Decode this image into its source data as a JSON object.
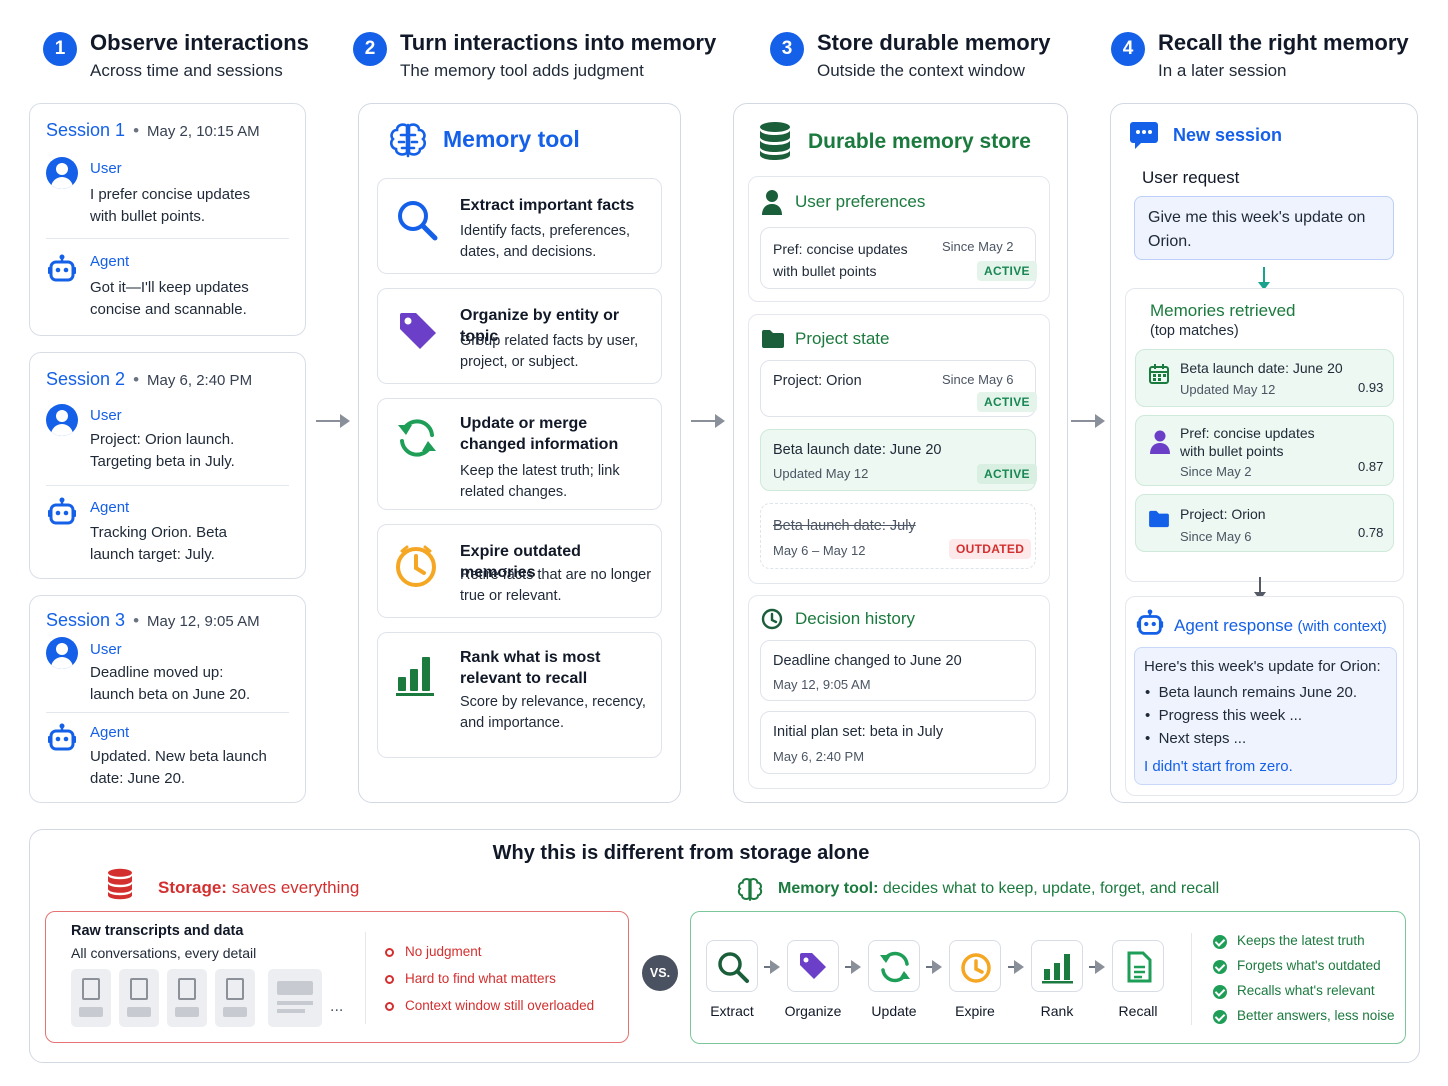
{
  "steps": [
    {
      "num": "1",
      "title": "Observe interactions",
      "subtitle": "Across time and sessions"
    },
    {
      "num": "2",
      "title": "Turn interactions into memory",
      "subtitle": "The memory tool adds judgment"
    },
    {
      "num": "3",
      "title": "Store durable memory",
      "subtitle": "Outside the context window"
    },
    {
      "num": "4",
      "title": "Recall the right memory",
      "subtitle": "In a later session"
    }
  ],
  "sessions": [
    {
      "title": "Session 1",
      "date": "May 2, 10:15 AM",
      "user_label": "User",
      "user_msg": "I prefer concise updates with bullet points.",
      "agent_label": "Agent",
      "agent_msg": "Got it—I'll keep updates concise and scannable."
    },
    {
      "title": "Session 2",
      "date": "May 6, 2:40 PM",
      "user_label": "User",
      "user_msg": "Project: Orion launch. Targeting beta in July.",
      "agent_label": "Agent",
      "agent_msg": "Tracking Orion. Beta launch target: July."
    },
    {
      "title": "Session 3",
      "date": "May 12, 9:05 AM",
      "user_label": "User",
      "user_msg": "Deadline moved up: launch beta on June 20.",
      "agent_label": "Agent",
      "agent_msg": "Updated. New beta launch date: June 20."
    }
  ],
  "memory_tool": {
    "title": "Memory tool",
    "features": [
      {
        "title": "Extract important facts",
        "desc": "Identify facts, preferences, dates, and decisions.",
        "icon": "search-icon"
      },
      {
        "title": "Organize by entity or topic",
        "desc": "Group related facts by user, project, or subject.",
        "icon": "tag-icon"
      },
      {
        "title": "Update or merge changed information",
        "desc": "Keep the latest truth; link related changes.",
        "icon": "refresh-icon"
      },
      {
        "title": "Expire outdated memories",
        "desc": "Retire facts that are no longer true or relevant.",
        "icon": "clock-icon"
      },
      {
        "title": "Rank what is most relevant to recall",
        "desc": "Score by relevance, recency, and importance.",
        "icon": "bar-chart-icon"
      }
    ]
  },
  "store": {
    "title": "Durable memory store",
    "preferences": {
      "title": "User preferences",
      "item": "Pref: concise updates with bullet points",
      "since": "Since May 2",
      "status": "ACTIVE"
    },
    "project": {
      "title": "Project state",
      "items": [
        {
          "text": "Project: Orion",
          "meta": "Since May 6",
          "status": "ACTIVE"
        },
        {
          "text": "Beta launch date: June 20",
          "meta": "Updated May 12",
          "status": "ACTIVE"
        },
        {
          "text": "Beta launch date: July",
          "meta": "May 6 – May 12",
          "status": "OUTDATED"
        }
      ]
    },
    "decisions": {
      "title": "Decision history",
      "items": [
        {
          "text": "Deadline changed to June 20",
          "meta": "May 12, 9:05 AM"
        },
        {
          "text": "Initial plan set: beta in July",
          "meta": "May 6, 2:40 PM"
        }
      ]
    }
  },
  "recall": {
    "title": "New session",
    "request_label": "User request",
    "request_text": "Give me this week's update on Orion.",
    "retrieved_title": "Memories retrieved",
    "retrieved_sub": "(top matches)",
    "matches": [
      {
        "text": "Beta launch date: June 20",
        "meta": "Updated May 12",
        "score": "0.93"
      },
      {
        "text": "Pref: concise updates with bullet points",
        "meta": "Since May 2",
        "score": "0.87"
      },
      {
        "text": "Project: Orion",
        "meta": "Since May 6",
        "score": "0.78"
      }
    ],
    "response_title": "Agent response",
    "response_sub": "(with context)",
    "response_intro": "Here's this week's update for Orion:",
    "bullets": [
      "Beta launch remains June 20.",
      "Progress this week ...",
      "Next steps ..."
    ],
    "closing": "I didn't start from zero."
  },
  "compare": {
    "title": "Why this is different from storage alone",
    "storage_label": "Storage:",
    "storage_desc": "saves everything",
    "raw_title": "Raw transcripts and data",
    "raw_sub": "All conversations, every detail",
    "ellipsis": "...",
    "problems": [
      "No judgment",
      "Hard to find what matters",
      "Context window still overloaded"
    ],
    "vs": "VS.",
    "tool_label": "Memory tool:",
    "tool_desc": "decides what to keep, update, forget, and recall",
    "pipeline": [
      "Extract",
      "Organize",
      "Update",
      "Expire",
      "Rank",
      "Recall"
    ],
    "benefits": [
      "Keeps the latest truth",
      "Forgets what's outdated",
      "Recalls what's relevant",
      "Better answers, less noise"
    ]
  },
  "colors": {
    "blue": "#1560e8",
    "green": "#1b7a3e",
    "red": "#d32f2f",
    "amber": "#f5a623",
    "purple": "#6b3fc8"
  }
}
